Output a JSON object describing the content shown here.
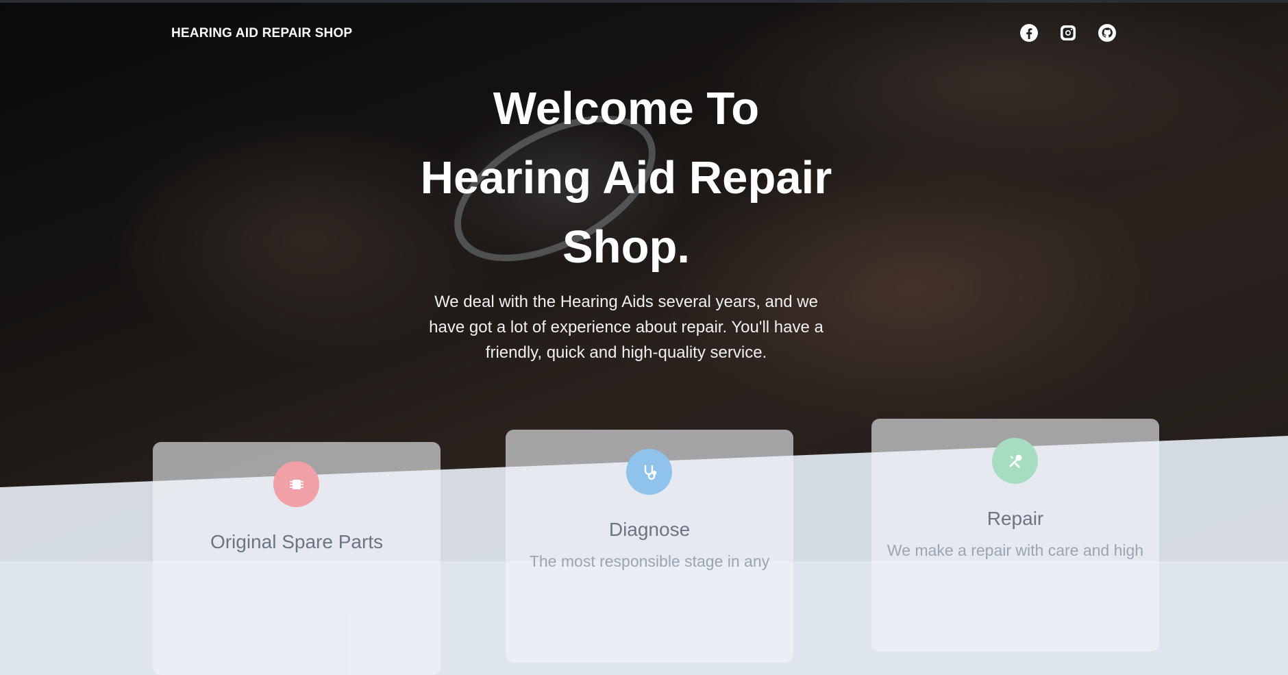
{
  "brand": "HEARING AID REPAIR SHOP",
  "social": [
    {
      "name": "facebook-icon"
    },
    {
      "name": "instagram-icon"
    },
    {
      "name": "github-icon"
    }
  ],
  "hero": {
    "title_line1": "Welcome To",
    "title_line2": "Hearing Aid Repair",
    "title_line3": "Shop.",
    "text_line1": "We deal with the Hearing Aids several years, and we",
    "text_line2": "have got a lot of experience about repair. You'll have a",
    "text_line3": "friendly, quick and high-quality service."
  },
  "cards": [
    {
      "title": "Original Spare Parts",
      "text": "",
      "icon": "chip-icon",
      "color": "#f0a0a6"
    },
    {
      "title": "Diagnose",
      "text": "The most responsible stage in any",
      "icon": "stethoscope-icon",
      "color": "#90c3ec"
    },
    {
      "title": "Repair",
      "text": "We make a repair with care and high",
      "icon": "tools-icon",
      "color": "#a8dcc0"
    }
  ]
}
